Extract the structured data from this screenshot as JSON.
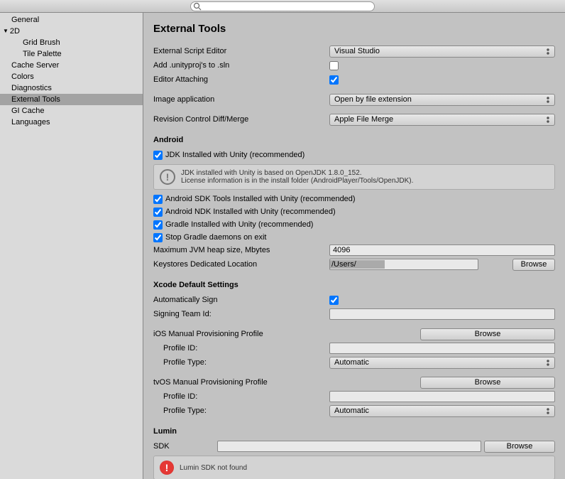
{
  "topbar": {
    "search_placeholder": ""
  },
  "sidebar": {
    "items": [
      {
        "label": "General"
      },
      {
        "label": "2D",
        "expanded": true
      },
      {
        "label": "Grid Brush",
        "child": true
      },
      {
        "label": "Tile Palette",
        "child": true
      },
      {
        "label": "Cache Server"
      },
      {
        "label": "Colors"
      },
      {
        "label": "Diagnostics"
      },
      {
        "label": "External Tools",
        "selected": true
      },
      {
        "label": "GI Cache"
      },
      {
        "label": "Languages"
      }
    ]
  },
  "page": {
    "title": "External Tools",
    "editor": {
      "script_editor_label": "External Script Editor",
      "script_editor_value": "Visual Studio",
      "add_unityproj_label": "Add .unityproj's to .sln",
      "add_unityproj_checked": false,
      "editor_attaching_label": "Editor Attaching",
      "editor_attaching_checked": true
    },
    "image_app": {
      "label": "Image application",
      "value": "Open by file extension"
    },
    "revision": {
      "label": "Revision Control Diff/Merge",
      "value": "Apple File Merge"
    },
    "android": {
      "heading": "Android",
      "jdk_label": "JDK Installed with Unity (recommended)",
      "jdk_checked": true,
      "jdk_info_line1": "JDK installed with Unity is based on OpenJDK 1.8.0_152.",
      "jdk_info_line2": "License information is in the install folder (AndroidPlayer/Tools/OpenJDK).",
      "sdk_label": "Android SDK Tools Installed with Unity (recommended)",
      "sdk_checked": true,
      "ndk_label": "Android NDK Installed with Unity (recommended)",
      "ndk_checked": true,
      "gradle_label": "Gradle Installed with Unity (recommended)",
      "gradle_checked": true,
      "stop_gradle_label": "Stop Gradle daemons on exit",
      "stop_gradle_checked": true,
      "jvm_label": "Maximum JVM heap size, Mbytes",
      "jvm_value": "4096",
      "keystore_label": "Keystores Dedicated Location",
      "keystore_value": "/Users/",
      "browse": "Browse"
    },
    "xcode": {
      "heading": "Xcode Default Settings",
      "autosign_label": "Automatically Sign",
      "autosign_checked": true,
      "team_label": "Signing Team Id:",
      "team_value": "",
      "ios_heading": "iOS Manual Provisioning Profile",
      "tvos_heading": "tvOS Manual Provisioning Profile",
      "profile_id_label": "Profile ID:",
      "profile_type_label": "Profile Type:",
      "profile_type_value": "Automatic",
      "browse": "Browse"
    },
    "lumin": {
      "heading": "Lumin",
      "sdk_label": "SDK",
      "sdk_value": "",
      "browse": "Browse",
      "error": "Lumin SDK not found"
    }
  }
}
